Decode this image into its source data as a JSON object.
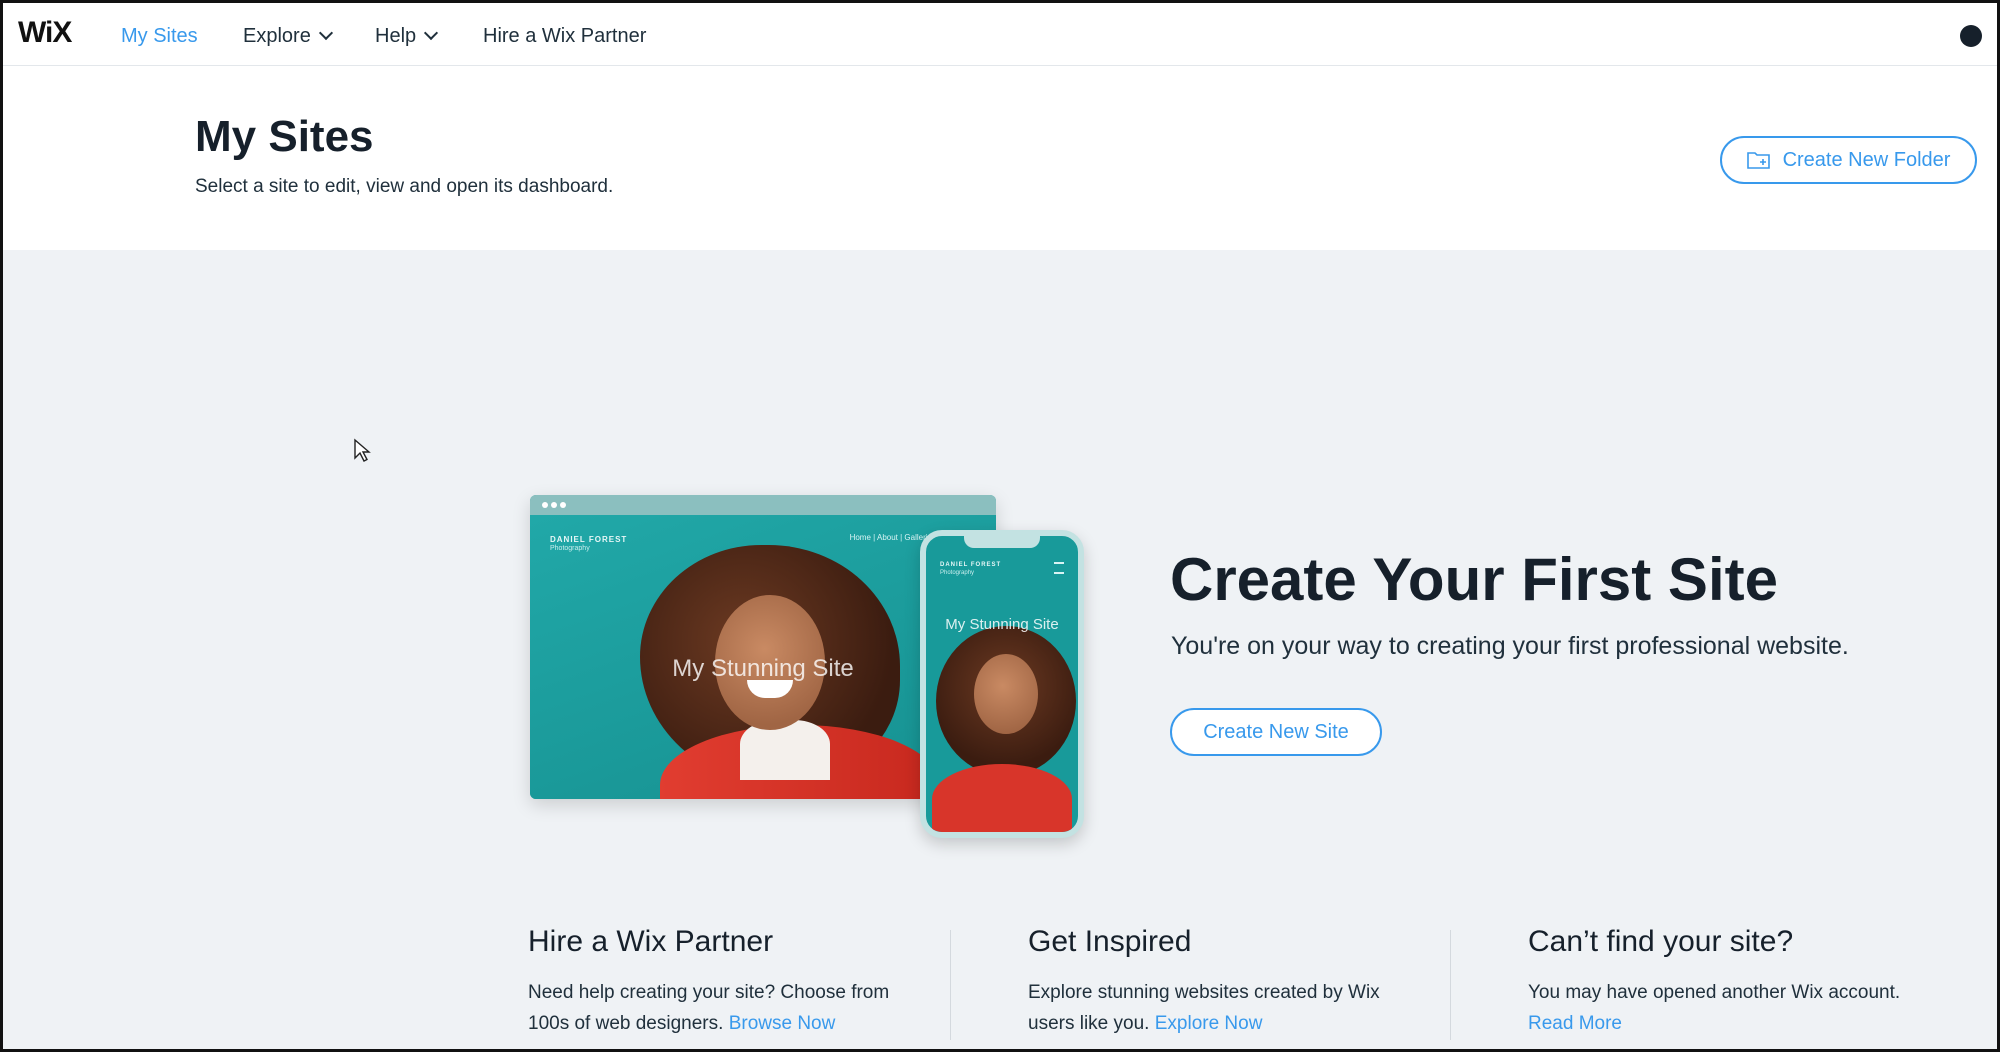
{
  "nav": {
    "logo": "WiX",
    "items": [
      {
        "label": "My Sites",
        "active": true
      },
      {
        "label": "Explore",
        "dropdown": true
      },
      {
        "label": "Help",
        "dropdown": true
      },
      {
        "label": "Hire a Wix Partner"
      }
    ],
    "account_icon": "user-avatar-icon"
  },
  "header": {
    "title": "My Sites",
    "subtitle": "Select a site to edit, view and open its dashboard.",
    "create_folder_label": "Create New Folder",
    "create_folder_icon": "folder-plus-icon"
  },
  "illustration": {
    "desktop_brand": "DANIEL FOREST",
    "desktop_brand_sub": "Photography",
    "desktop_menu": "Home  |  About  |  Galleries",
    "desktop_title": "My Stunning Site",
    "phone_brand": "DANIEL FOREST",
    "phone_brand_sub": "Photography",
    "phone_title": "My Stunning Site"
  },
  "cta": {
    "title": "Create Your First Site",
    "subtitle": "You're on your way to creating your first professional website.",
    "button_label": "Create New Site"
  },
  "columns": [
    {
      "title": "Hire a Wix Partner",
      "text": "Need help creating your site? Choose from 100s of web designers. ",
      "link": "Browse Now"
    },
    {
      "title": "Get Inspired",
      "text": "Explore stunning websites created by Wix users like you. ",
      "link": "Explore Now"
    },
    {
      "title": "Can’t find your site?",
      "text": "You may have opened another Wix account. ",
      "link": "Read More"
    }
  ],
  "colors": {
    "accent": "#3899ec",
    "background": "#eff2f5",
    "text_dark": "#16202b"
  }
}
